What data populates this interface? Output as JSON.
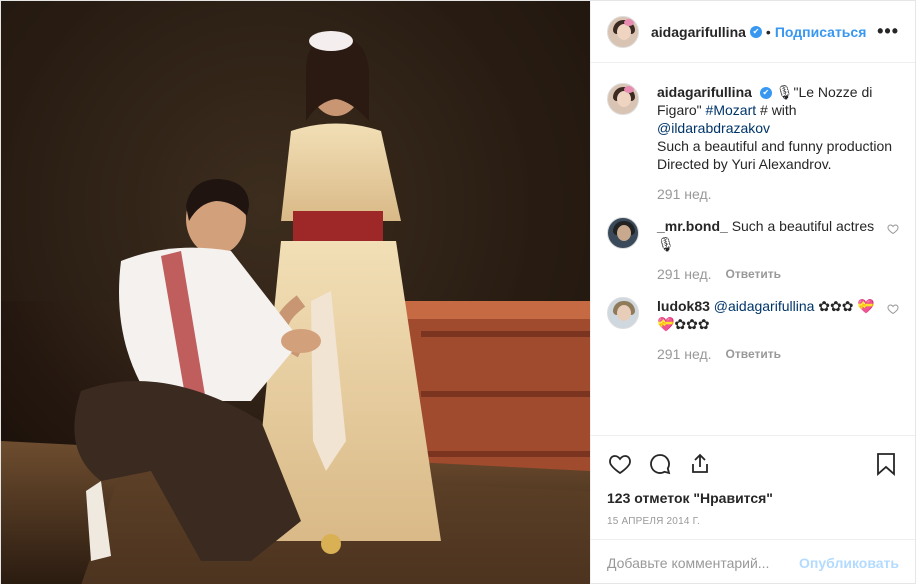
{
  "post": {
    "username": "aidagarifullina",
    "follow_label": "Подписаться",
    "separator": "•",
    "more_label": "•••",
    "verified_mark": "✔"
  },
  "caption": {
    "username": "aidagarifullina",
    "text_1": "🎙\"Le Nozze di Figaro\" ",
    "hashtag": "#Mozart",
    "text_2": " # with ",
    "mention": "@ildarabdrazakov",
    "line_2": "Such a beautiful and funny production",
    "line_3": "Directed by Yuri Alexandrov.",
    "time": "291 нед."
  },
  "comments": [
    {
      "username": "_mr.bond_",
      "text": "Such a beautiful actres🎙",
      "time": "291 нед.",
      "reply_label": "Ответить"
    },
    {
      "username": "ludok83",
      "mention": "@aidagarifullina",
      "text": "✿✿✿ 💝💝✿✿✿",
      "time": "291 нед.",
      "reply_label": "Ответить"
    }
  ],
  "likes": "123 отметок \"Нравится\"",
  "date": "15 апреля 2014 г.",
  "add_comment": {
    "placeholder": "Добавьте комментарий...",
    "publish_label": "Опубликовать"
  },
  "colors": {
    "accent": "#3897f0",
    "link": "#003569",
    "muted": "#999999",
    "publish_disabled": "#b3dbff"
  },
  "icons": [
    "heart-icon",
    "comment-icon",
    "share-icon",
    "bookmark-icon"
  ]
}
